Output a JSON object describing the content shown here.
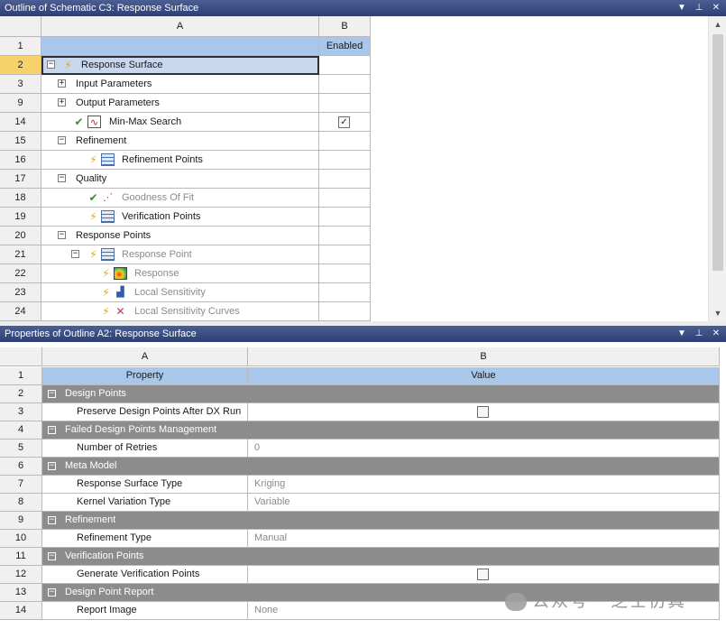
{
  "outline": {
    "title": "Outline of Schematic C3: Response Surface",
    "col_a": "A",
    "col_b": "B",
    "header_row": "1",
    "enabled_label": "Enabled",
    "rows": [
      {
        "num": "2",
        "label": "Response Surface"
      },
      {
        "num": "3",
        "label": "Input Parameters"
      },
      {
        "num": "9",
        "label": "Output Parameters"
      },
      {
        "num": "14",
        "label": "Min-Max Search",
        "checked": "✓"
      },
      {
        "num": "15",
        "label": "Refinement"
      },
      {
        "num": "16",
        "label": "Refinement Points"
      },
      {
        "num": "17",
        "label": "Quality"
      },
      {
        "num": "18",
        "label": "Goodness Of Fit"
      },
      {
        "num": "19",
        "label": "Verification Points"
      },
      {
        "num": "20",
        "label": "Response Points"
      },
      {
        "num": "21",
        "label": "Response Point"
      },
      {
        "num": "22",
        "label": "Response"
      },
      {
        "num": "23",
        "label": "Local Sensitivity"
      },
      {
        "num": "24",
        "label": "Local Sensitivity Curves"
      }
    ]
  },
  "properties": {
    "title": "Properties of Outline A2: Response Surface",
    "col_a": "A",
    "col_b": "B",
    "header_row": "1",
    "property_header": "Property",
    "value_header": "Value",
    "rows": [
      {
        "num": "2",
        "label": "Design Points"
      },
      {
        "num": "3",
        "label": "Preserve Design Points After DX Run"
      },
      {
        "num": "4",
        "label": "Failed Design Points Management"
      },
      {
        "num": "5",
        "label": "Number of Retries",
        "value": "0"
      },
      {
        "num": "6",
        "label": "Meta Model"
      },
      {
        "num": "7",
        "label": "Response Surface Type",
        "value": "Kriging"
      },
      {
        "num": "8",
        "label": "Kernel Variation Type",
        "value": "Variable"
      },
      {
        "num": "9",
        "label": "Refinement"
      },
      {
        "num": "10",
        "label": "Refinement Type",
        "value": "Manual"
      },
      {
        "num": "11",
        "label": "Verification Points"
      },
      {
        "num": "12",
        "label": "Generate Verification Points"
      },
      {
        "num": "13",
        "label": "Design Point Report"
      },
      {
        "num": "14",
        "label": "Report Image",
        "value": "None"
      }
    ]
  },
  "watermark": "公众号 · 芝士仿真",
  "icons": [
    "collapse-icon",
    "expand-icon",
    "lightning-icon",
    "checkmark-icon",
    "min-max-curve-icon",
    "table-icon",
    "goodness-of-fit-icon",
    "response-contour-icon",
    "bar-chart-icon",
    "sensitivity-curves-icon",
    "pin-icon",
    "close-icon",
    "dropdown-arrow-icon"
  ]
}
